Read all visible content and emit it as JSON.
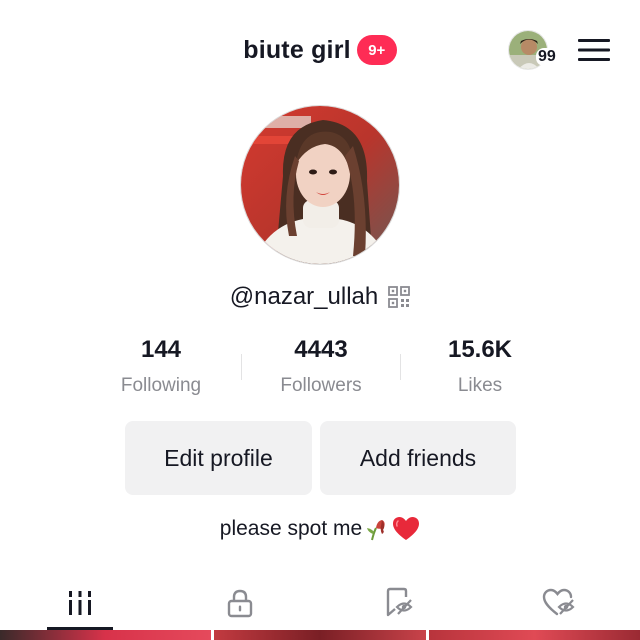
{
  "header": {
    "title": "biute girl",
    "notification_badge": "9+",
    "mini_avatar_count": "99",
    "menu_icon": "hamburger-menu-icon"
  },
  "profile": {
    "username": "@nazar_ullah",
    "qr_icon": "qr-code-icon"
  },
  "stats": [
    {
      "value": "144",
      "label": "Following"
    },
    {
      "value": "4443",
      "label": "Followers"
    },
    {
      "value": "15.6K",
      "label": "Likes"
    }
  ],
  "buttons": {
    "edit_profile": "Edit profile",
    "add_friends": "Add friends"
  },
  "bio": {
    "text": "please spot me",
    "emojis": [
      "wilted-rose-icon",
      "red-heart-icon"
    ]
  },
  "tabs": [
    {
      "icon": "videos-grid-icon",
      "active": true
    },
    {
      "icon": "lock-icon",
      "active": false
    },
    {
      "icon": "bookmark-hidden-icon",
      "active": false
    },
    {
      "icon": "liked-hidden-icon",
      "active": false
    }
  ],
  "colors": {
    "accent": "#fe2c55",
    "text": "#161823",
    "muted": "#8a8b91",
    "button_bg": "#f1f1f2"
  }
}
